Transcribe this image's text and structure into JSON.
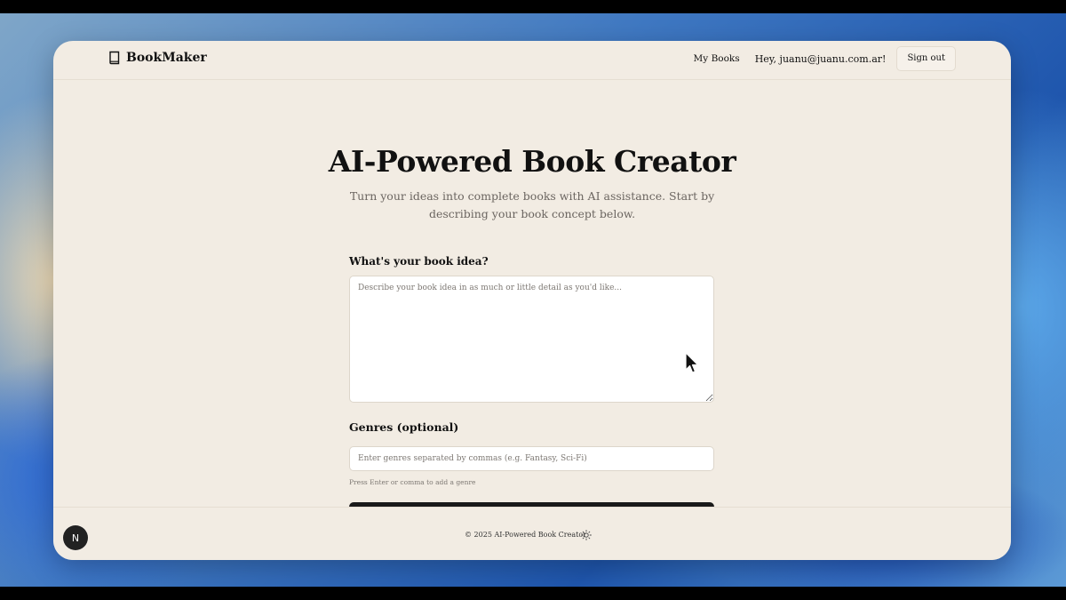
{
  "header": {
    "brand": "BookMaker",
    "brand_icon": "book-icon",
    "nav": {
      "my_books": "My Books",
      "greeting": "Hey, juanu@juanu.com.ar!",
      "sign_out": "Sign out"
    }
  },
  "hero": {
    "title": "AI-Powered Book Creator",
    "subtitle": "Turn your ideas into complete books with AI assistance. Start by describing your book concept below."
  },
  "form": {
    "idea_label": "What's your book idea?",
    "idea_placeholder": "Describe your book idea in as much or little detail as you'd like...",
    "idea_value": "",
    "genres_label": "Genres (optional)",
    "genres_placeholder": "Enter genres separated by commas (e.g. Fantasy, Sci-Fi)",
    "genres_value": "",
    "genres_hint": "Press Enter or comma to add a genre"
  },
  "footer": {
    "copyright": "© 2025 AI-Powered Book Creator",
    "theme_icon": "sun-icon"
  },
  "dev_badge": {
    "label": "N"
  },
  "colors": {
    "page_background": "#f2ece3",
    "text": "#111111",
    "muted_text": "#6b6560",
    "primary_button": "#1a1a1a"
  }
}
